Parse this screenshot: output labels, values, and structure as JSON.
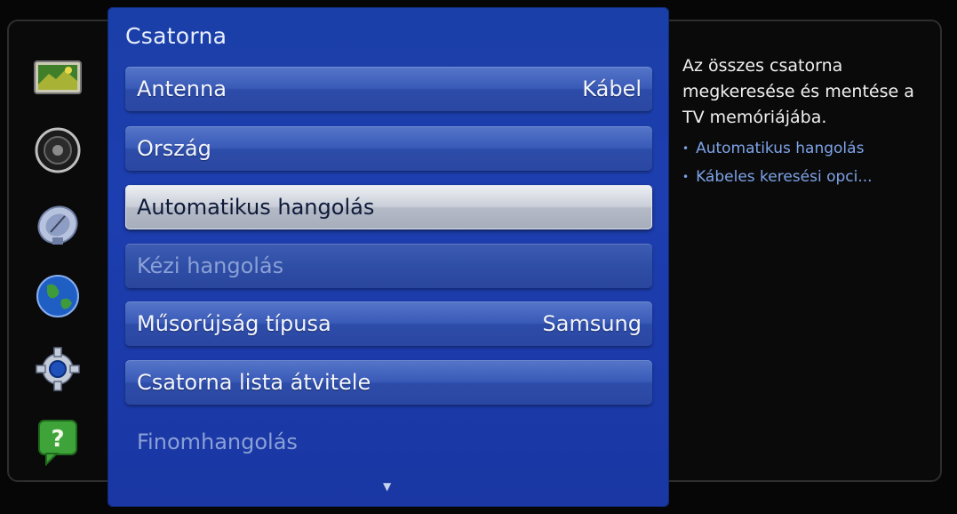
{
  "panel": {
    "title": "Csatorna"
  },
  "menu": {
    "items": [
      {
        "label": "Antenna",
        "value": "Kábel",
        "state": "normal"
      },
      {
        "label": "Ország",
        "value": "",
        "state": "normal"
      },
      {
        "label": "Automatikus hangolás",
        "value": "",
        "state": "selected"
      },
      {
        "label": "Kézi hangolás",
        "value": "",
        "state": "disabled"
      },
      {
        "label": "Műsorújság típusa",
        "value": "Samsung",
        "state": "normal"
      },
      {
        "label": "Csatorna lista átvitele",
        "value": "",
        "state": "normal"
      },
      {
        "label": "Finomhangolás",
        "value": "",
        "state": "disabled"
      }
    ],
    "scroll_indicator": "▼"
  },
  "help": {
    "description": "Az összes csatorna megkeresése és mentése a TV memóriájába.",
    "links": [
      "Automatikus hangolás",
      "Kábeles keresési opci..."
    ]
  },
  "rail": {
    "icons": [
      "picture-icon",
      "sound-icon",
      "channel-antenna-icon",
      "network-globe-icon",
      "system-gear-icon",
      "support-help-icon"
    ]
  },
  "colors": {
    "panel": "#1d3eb0",
    "selected": "#c9ced8",
    "help_link": "#7ea3e8"
  }
}
